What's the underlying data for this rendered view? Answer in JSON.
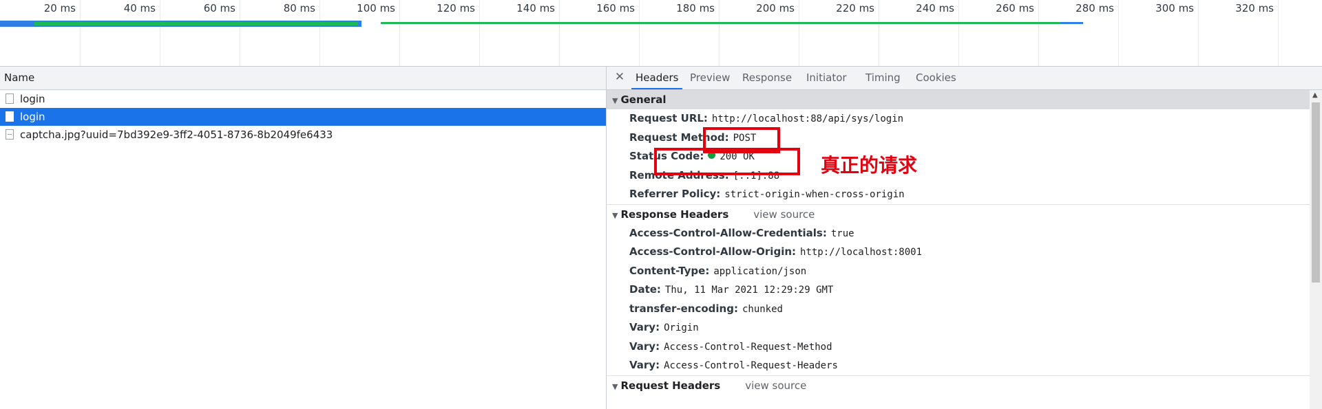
{
  "timeline": {
    "ticks": [
      "20 ms",
      "40 ms",
      "60 ms",
      "80 ms",
      "100 ms",
      "120 ms",
      "140 ms",
      "160 ms",
      "180 ms",
      "200 ms",
      "220 ms",
      "240 ms",
      "260 ms",
      "280 ms",
      "300 ms",
      "320 ms"
    ],
    "colors": {
      "waterfall_green": "#1db954",
      "waiting_blue": "#2f7fe6",
      "queue_gray": "#b9c0cb"
    }
  },
  "list": {
    "header": "Name",
    "rows": [
      {
        "name": "login",
        "selected": false
      },
      {
        "name": "login",
        "selected": true
      },
      {
        "name": "captcha.jpg?uuid=7bd392e9-3ff2-4051-8736-8b2049fe6433",
        "selected": false
      }
    ]
  },
  "detail": {
    "close_icon": "close-icon",
    "tabs": [
      "Headers",
      "Preview",
      "Response",
      "Initiator",
      "Timing",
      "Cookies"
    ],
    "active_tab": "Headers",
    "general": {
      "title": "General",
      "items": [
        {
          "key": "Request URL:",
          "value": "http://localhost:88/api/sys/login"
        },
        {
          "key": "Request Method:",
          "value": "POST"
        },
        {
          "key": "Status Code:",
          "value": "200 OK"
        },
        {
          "key": "Remote Address:",
          "value": "[::1]:88"
        },
        {
          "key": "Referrer Policy:",
          "value": "strict-origin-when-cross-origin"
        }
      ]
    },
    "response_headers": {
      "title": "Response Headers",
      "view_source": "view source",
      "items": [
        {
          "key": "Access-Control-Allow-Credentials:",
          "value": "true"
        },
        {
          "key": "Access-Control-Allow-Origin:",
          "value": "http://localhost:8001"
        },
        {
          "key": "Content-Type:",
          "value": "application/json"
        },
        {
          "key": "Date:",
          "value": "Thu, 11 Mar 2021 12:29:29 GMT"
        },
        {
          "key": "transfer-encoding:",
          "value": "chunked"
        },
        {
          "key": "Vary:",
          "value": "Origin"
        },
        {
          "key": "Vary:",
          "value": "Access-Control-Request-Method"
        },
        {
          "key": "Vary:",
          "value": "Access-Control-Request-Headers"
        }
      ]
    },
    "request_headers": {
      "title": "Request Headers",
      "view_source": "view source"
    }
  },
  "annotation": {
    "text": "真正的请求",
    "color": "#e3000f"
  }
}
